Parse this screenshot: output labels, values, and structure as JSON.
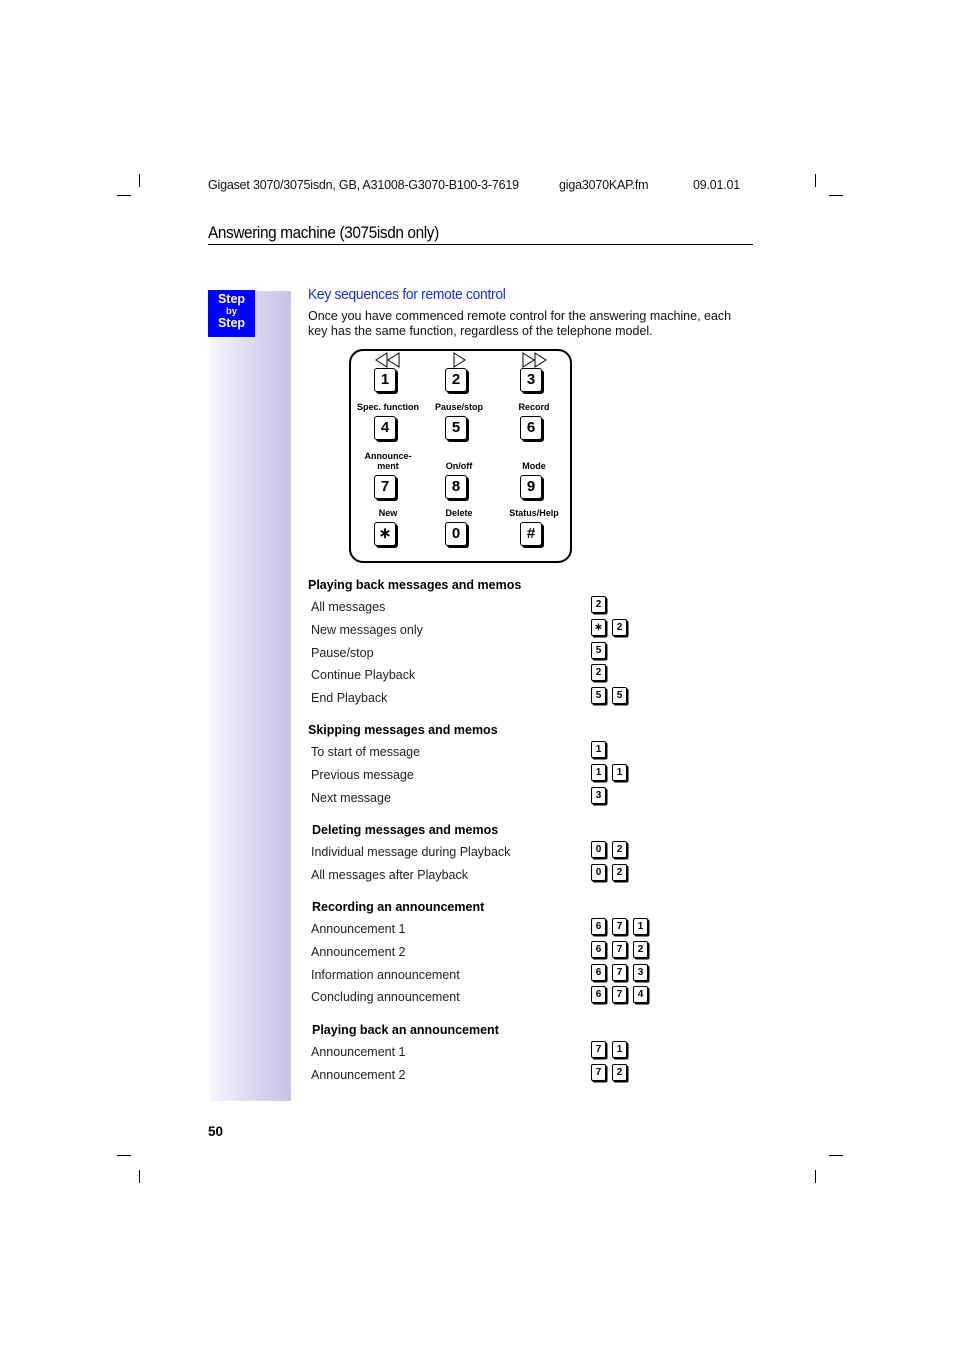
{
  "header": {
    "doc_ref": "Gigaset 3070/3075isdn, GB, A31008-G3070-B100-3-7619",
    "file": "giga3070KAP.fm",
    "date": "09.01.01"
  },
  "chapter_title": "Answering machine (3075isdn only)",
  "step_badge": {
    "line1": "Step",
    "line2": "by",
    "line3": "Step"
  },
  "section": {
    "title": "Key sequences for remote control",
    "intro": "Once you have commenced remote control for the answering machine, each key has the same function, regardless of the telephone model."
  },
  "keypad": {
    "keys": [
      {
        "key": "1",
        "label": "",
        "icon": "rewind-icon"
      },
      {
        "key": "2",
        "label": "",
        "icon": "play-icon"
      },
      {
        "key": "3",
        "label": "",
        "icon": "fast-forward-icon"
      },
      {
        "key": "4",
        "label": "Spec. function"
      },
      {
        "key": "5",
        "label": "Pause/stop"
      },
      {
        "key": "6",
        "label": "Record"
      },
      {
        "key": "7",
        "label": "Announce-\nment"
      },
      {
        "key": "8",
        "label": "On/off"
      },
      {
        "key": "9",
        "label": "Mode"
      },
      {
        "key": "∗",
        "label": "New"
      },
      {
        "key": "0",
        "label": "Delete"
      },
      {
        "key": "#",
        "label": "Status/Help"
      }
    ]
  },
  "groups": [
    {
      "title": "Playing back messages and memos",
      "rows": [
        {
          "label": "All messages",
          "keys": [
            "2"
          ]
        },
        {
          "label": "New messages only",
          "keys": [
            "∗",
            "2"
          ]
        },
        {
          "label": "Pause/stop",
          "keys": [
            "5"
          ]
        },
        {
          "label": "Continue Playback",
          "keys": [
            "2"
          ]
        },
        {
          "label": "End Playback",
          "keys": [
            "5",
            "5"
          ]
        }
      ]
    },
    {
      "title": "Skipping messages and memos",
      "rows": [
        {
          "label": "To start of message",
          "keys": [
            "1"
          ]
        },
        {
          "label": "Previous message",
          "keys": [
            "1",
            "1"
          ]
        },
        {
          "label": "Next message",
          "keys": [
            "3"
          ]
        }
      ]
    },
    {
      "title": "Deleting messages and memos",
      "rows": [
        {
          "label": "Individual message during Playback",
          "keys": [
            "0",
            "2"
          ]
        },
        {
          "label": "All messages after Playback",
          "keys": [
            "0",
            "2"
          ]
        }
      ]
    },
    {
      "title": "Recording an announcement",
      "rows": [
        {
          "label": "Announcement 1",
          "keys": [
            "6",
            "7",
            "1"
          ]
        },
        {
          "label": "Announcement 2",
          "keys": [
            "6",
            "7",
            "2"
          ]
        },
        {
          "label": "Information announcement",
          "keys": [
            "6",
            "7",
            "3"
          ]
        },
        {
          "label": "Concluding announcement",
          "keys": [
            "6",
            "7",
            "4"
          ]
        }
      ]
    },
    {
      "title": "Playing back an announcement",
      "rows": [
        {
          "label": "Announcement 1",
          "keys": [
            "7",
            "1"
          ]
        },
        {
          "label": "Announcement 2",
          "keys": [
            "7",
            "2"
          ]
        }
      ]
    }
  ],
  "page_number": "50"
}
